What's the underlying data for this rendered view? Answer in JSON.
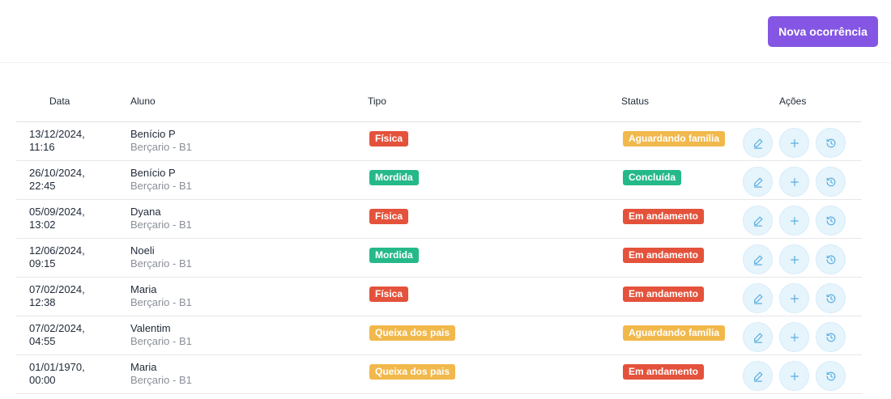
{
  "header": {
    "new_button_label": "Nova ocorrência"
  },
  "columns": {
    "data": "Data",
    "aluno": "Aluno",
    "tipo": "Tipo",
    "status": "Status",
    "acoes": "Ações"
  },
  "colors": {
    "Física": "#e4523b",
    "Mordida": "#25b98a",
    "Queixa dos pais": "#f1b84b",
    "Aguardando família": "#f1b84b",
    "Concluída": "#25b98a",
    "Em andamento": "#e4523b"
  },
  "rows": [
    {
      "date": "13/12/2024, 11:16",
      "name": "Benício P",
      "class": "Berçario - B1",
      "tipo": "Física",
      "status": "Aguardando família"
    },
    {
      "date": "26/10/2024, 22:45",
      "name": "Benício P",
      "class": "Berçario - B1",
      "tipo": "Mordida",
      "status": "Concluída"
    },
    {
      "date": "05/09/2024, 13:02",
      "name": "Dyana",
      "class": "Berçario - B1",
      "tipo": "Física",
      "status": "Em andamento"
    },
    {
      "date": "12/06/2024, 09:15",
      "name": "Noeli",
      "class": "Berçario - B1",
      "tipo": "Mordida",
      "status": "Em andamento"
    },
    {
      "date": "07/02/2024, 12:38",
      "name": "Maria",
      "class": "Berçario - B1",
      "tipo": "Física",
      "status": "Em andamento"
    },
    {
      "date": "07/02/2024, 04:55",
      "name": "Valentim",
      "class": "Berçario - B1",
      "tipo": "Queixa dos pais",
      "status": "Aguardando família"
    },
    {
      "date": "01/01/1970, 00:00",
      "name": "Maria",
      "class": "Berçario - B1",
      "tipo": "Queixa dos pais",
      "status": "Em andamento"
    }
  ],
  "icons": {
    "edit": "pencil-icon",
    "add": "plus-icon",
    "history": "history-icon"
  }
}
